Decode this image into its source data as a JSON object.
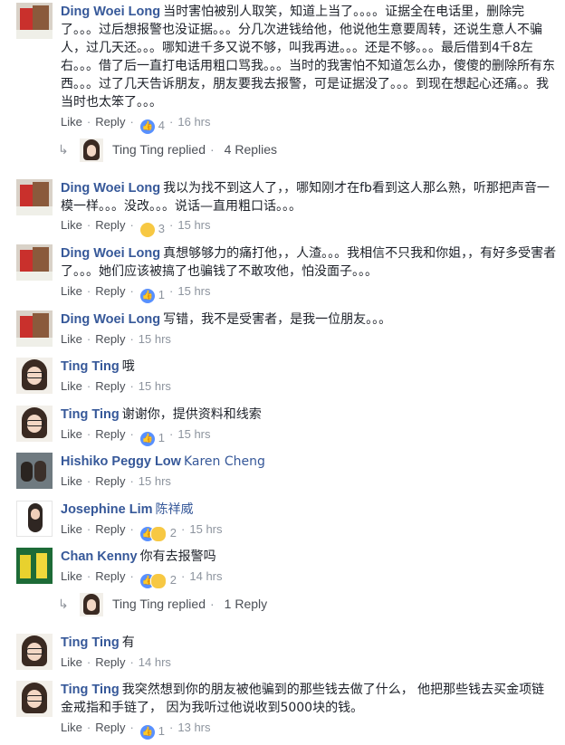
{
  "labels": {
    "like": "Like",
    "reply": "Reply",
    "sep": "·"
  },
  "colors": {
    "name": "#365899",
    "meta": "#8d949e",
    "like_icon": "#5890ff",
    "emoji": "#f7c843"
  },
  "comments": [
    {
      "name": "Ding Woei Long",
      "text": "当时害怕被别人取笑，知道上当了。。。。证据全在电话里，删除完了。。。过后想报警也没证据。。。分几次进钱给他，他说他生意要周转，还说生意人不骗人，过几天还。。。哪知进千多又说不够，叫我再进。。。还是不够。。。最后借到4千8左右。。。借了后一直打电话用粗口骂我。。。当时的我害怕不知道怎么办，傻傻的删除所有东西。。。过了几天告诉朋友，朋友要我去报警，可是证据没了。。。到现在想起心还痛。。我当时也太笨了。。。",
      "reactions": [
        "like-icon"
      ],
      "count": "4",
      "time": "16 hrs"
    },
    {
      "name": "Ding Woei Long",
      "text": "我以为找不到这人了，，哪知刚才在fb看到这人那么熟，听那把声音一模一样。。。没改。。。说话—直用粗口话。。。",
      "reactions": [
        "sad-icon"
      ],
      "count": "3",
      "time": "15 hrs"
    },
    {
      "name": "Ding Woei Long",
      "text": "真想够够力的痛打他，，人渣。。。我相信不只我和你姐，，有好多受害者了。。。她们应该被搞了也骗钱了不敢攻他，怕没面子。。。",
      "reactions": [
        "like-icon"
      ],
      "count": "1",
      "time": "15 hrs"
    },
    {
      "name": "Ding Woei Long",
      "text": "写错，我不是受害者，是我一位朋友。。。",
      "reactions": [],
      "count": "",
      "time": "15 hrs"
    },
    {
      "name": "Ting Ting",
      "text": "哦",
      "reactions": [],
      "count": "",
      "time": "15 hrs"
    },
    {
      "name": "Ting Ting",
      "text": "谢谢你，提供资料和线索",
      "reactions": [
        "like-icon"
      ],
      "count": "1",
      "time": "15 hrs"
    },
    {
      "name": "Hishiko Peggy Low",
      "text": "Karen Cheng",
      "reactions": [],
      "count": "",
      "time": "15 hrs"
    },
    {
      "name": "Josephine Lim",
      "text": "陈祥威",
      "reactions": [
        "like-icon",
        "sad-icon"
      ],
      "count": "2",
      "time": "15 hrs"
    },
    {
      "name": "Chan Kenny",
      "text": "你有去报警吗",
      "reactions": [
        "like-icon",
        "wow-icon"
      ],
      "count": "2",
      "time": "14 hrs"
    },
    {
      "name": "Ting Ting",
      "text": "有",
      "reactions": [],
      "count": "",
      "time": "14 hrs"
    },
    {
      "name": "Ting Ting",
      "text": "我突然想到你的朋友被他骗到的那些钱去做了什么， 他把那些钱去买金项链金戒指和手链了， 因为我听过他说收到5000块的钱。",
      "reactions": [
        "like-icon"
      ],
      "count": "1",
      "time": "13 hrs"
    }
  ],
  "reply_summaries": [
    {
      "text": "Ting Ting replied",
      "count": "4 Replies"
    },
    {
      "text": "Ting Ting replied",
      "count": "1 Reply"
    }
  ]
}
